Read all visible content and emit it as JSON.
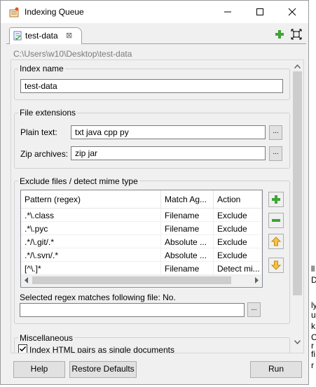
{
  "window": {
    "title": "Indexing Queue",
    "controls": {
      "minimize": "minimize",
      "maximize": "maximize",
      "close": "close"
    }
  },
  "tab": {
    "label": "test-data",
    "close_glyph": "⊠"
  },
  "path": "C:\\Users\\w10\\Desktop\\test-data",
  "index_name": {
    "title": "Index name",
    "value": "test-data"
  },
  "file_extensions": {
    "title": "File extensions",
    "plain_text_label": "Plain text:",
    "plain_text_value": "txt java cpp py",
    "zip_label": "Zip archives:",
    "zip_value": "zip jar",
    "browse_label": "..."
  },
  "exclude": {
    "title": "Exclude files / detect mime type",
    "columns": [
      "Pattern (regex)",
      "Match Ag...",
      "Action"
    ],
    "rows": [
      {
        "pattern": ".*\\.class",
        "match": "Filename",
        "action": "Exclude"
      },
      {
        "pattern": ".*\\.pyc",
        "match": "Filename",
        "action": "Exclude"
      },
      {
        "pattern": ".*/\\.git/.*",
        "match": "Absolute ...",
        "action": "Exclude"
      },
      {
        "pattern": ".*/\\.svn/.*",
        "match": "Absolute ...",
        "action": "Exclude"
      },
      {
        "pattern": "[^\\.]*",
        "match": "Filename",
        "action": "Detect mi..."
      }
    ],
    "regex_match_label": "Selected regex matches following file: No.",
    "regex_file_value": "",
    "browse_label": "..."
  },
  "misc": {
    "title": "Miscellaneous",
    "html_pairs_label": "Index HTML pairs as single documents",
    "html_pairs_checked": true
  },
  "footer": {
    "help": "Help",
    "restore": "Restore Defaults",
    "run": "Run"
  },
  "bg_window_glyphs": [
    "ll",
    "D",
    "ly",
    "u",
    "k",
    "C",
    "r",
    "fi",
    "r"
  ],
  "colors": {
    "add": "#3fa535",
    "remove": "#3fa535",
    "arrow": "#e8a317"
  }
}
